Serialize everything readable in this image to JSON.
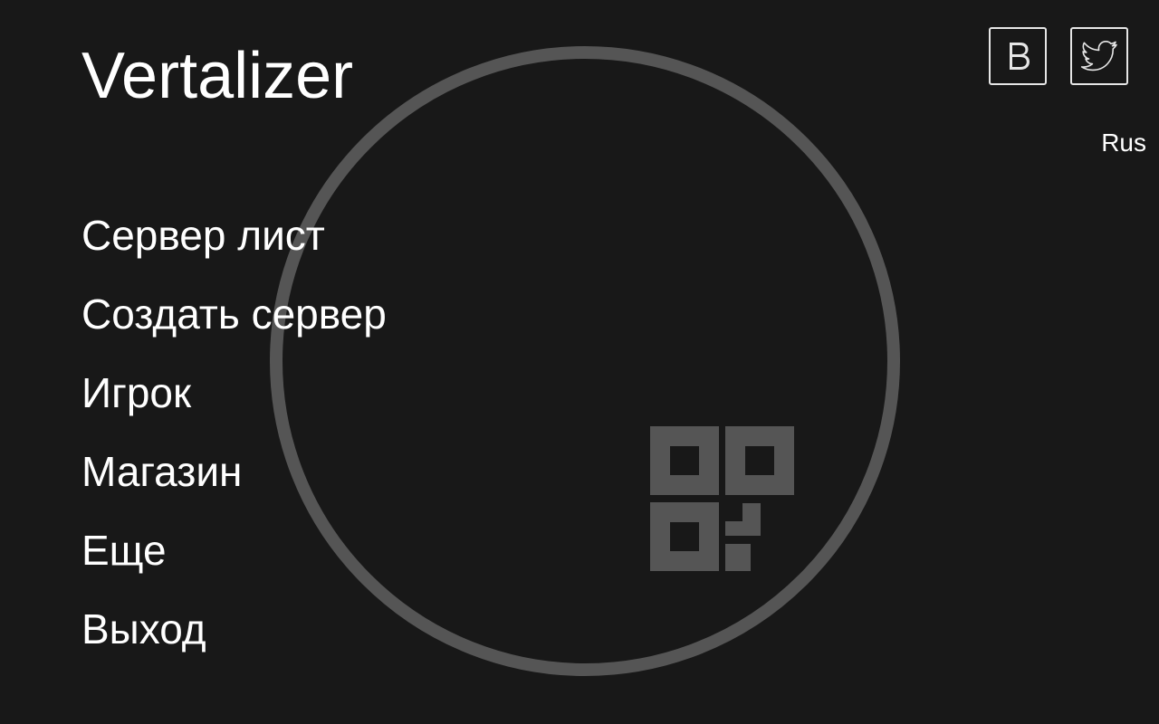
{
  "app": {
    "title": "Vertalizer"
  },
  "menu": {
    "items": [
      {
        "label": "Сервер лист"
      },
      {
        "label": "Создать сервер"
      },
      {
        "label": "Игрок"
      },
      {
        "label": "Магазин"
      },
      {
        "label": "Еще"
      },
      {
        "label": "Выход"
      }
    ]
  },
  "header": {
    "social": [
      {
        "icon": "vk-icon"
      },
      {
        "icon": "twitter-icon"
      }
    ],
    "language": "Rus"
  },
  "colors": {
    "background": "#181818",
    "text": "#ffffff",
    "logo": "#555555",
    "icon_border": "#e6e6e6"
  }
}
